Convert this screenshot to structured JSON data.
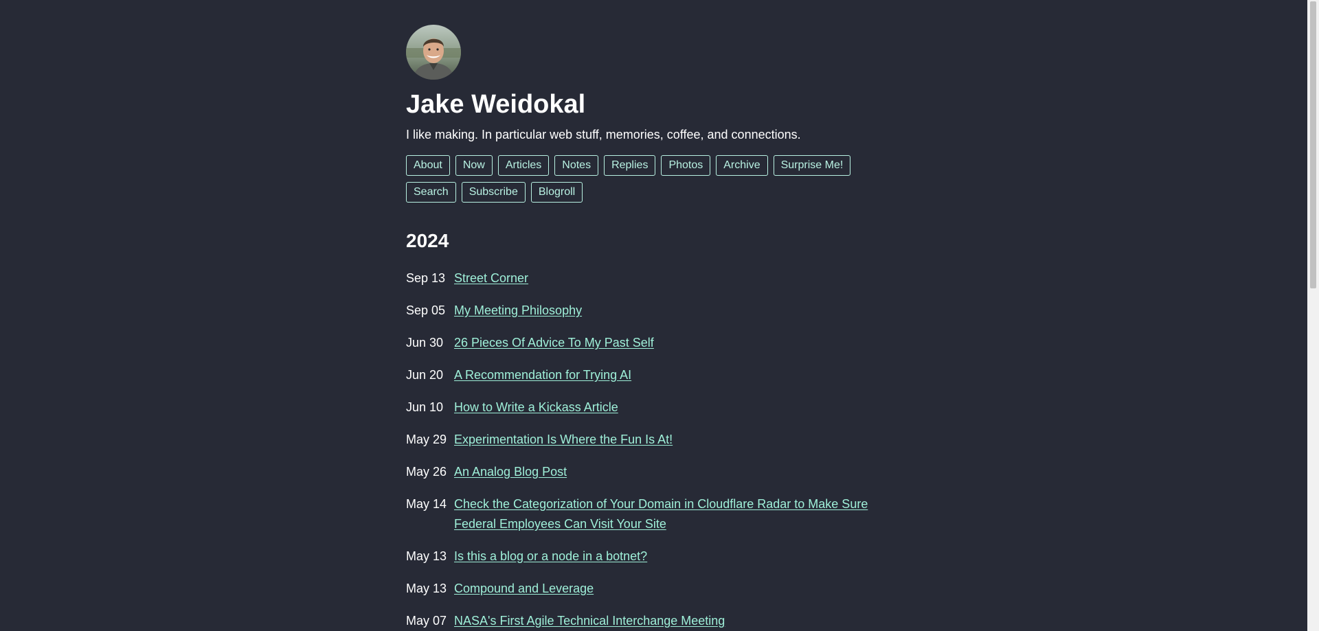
{
  "header": {
    "name": "Jake Weidokal",
    "tagline": "I like making. In particular web stuff, memories, coffee, and connections."
  },
  "nav": {
    "items": [
      "About",
      "Now",
      "Articles",
      "Notes",
      "Replies",
      "Photos",
      "Archive",
      "Surprise Me!",
      "Search",
      "Subscribe",
      "Blogroll"
    ]
  },
  "archive": {
    "year": "2024",
    "posts": [
      {
        "date": "Sep 13",
        "title": "Street Corner"
      },
      {
        "date": "Sep 05",
        "title": "My Meeting Philosophy"
      },
      {
        "date": "Jun 30",
        "title": "26 Pieces Of Advice To My Past Self"
      },
      {
        "date": "Jun 20",
        "title": "A Recommendation for Trying AI"
      },
      {
        "date": "Jun 10",
        "title": "How to Write a Kickass Article"
      },
      {
        "date": "May 29",
        "title": "Experimentation Is Where the Fun Is At!"
      },
      {
        "date": "May 26",
        "title": "An Analog Blog Post"
      },
      {
        "date": "May 14",
        "title": "Check the Categorization of Your Domain in Cloudflare Radar to Make Sure Federal Employees Can Visit Your Site"
      },
      {
        "date": "May 13",
        "title": "Is this a blog or a node in a botnet?"
      },
      {
        "date": "May 13",
        "title": "Compound and Leverage"
      },
      {
        "date": "May 07",
        "title": "NASA's First Agile Technical Interchange Meeting"
      }
    ]
  },
  "colors": {
    "background": "#272a36",
    "link": "#9ff0d9",
    "button_border": "#b9f2e3",
    "text": "#ffffff"
  },
  "icons": {
    "avatar": "profile-photo"
  }
}
